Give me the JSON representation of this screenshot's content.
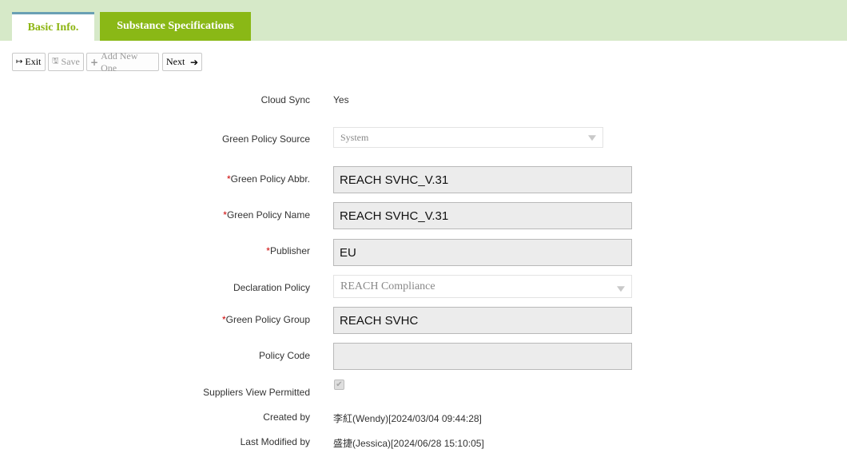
{
  "tabs": [
    {
      "label": "Basic Info."
    },
    {
      "label": "Substance Specifications"
    }
  ],
  "toolbar": {
    "exit_label": "Exit",
    "save_label": "Save",
    "add_label": "Add New One",
    "next_label": "Next"
  },
  "form": {
    "cloud_sync": {
      "label": "Cloud Sync",
      "value": "Yes"
    },
    "policy_source": {
      "label": "Green Policy Source",
      "value": "System"
    },
    "policy_abbr": {
      "label": "Green Policy Abbr.",
      "value": "REACH SVHC_V.31"
    },
    "policy_name": {
      "label": "Green Policy Name",
      "value": "REACH SVHC_V.31"
    },
    "publisher": {
      "label": "Publisher",
      "value": "EU"
    },
    "declaration_policy": {
      "label": "Declaration Policy",
      "value": "REACH Compliance"
    },
    "policy_group": {
      "label": "Green Policy Group",
      "value": "REACH SVHC"
    },
    "policy_code": {
      "label": "Policy Code",
      "value": ""
    },
    "suppliers_view": {
      "label": "Suppliers View Permitted",
      "checked": true
    },
    "created_by": {
      "label": "Created by",
      "value": "李紅(Wendy)[2024/03/04 09:44:28]"
    },
    "last_modified_by": {
      "label": "Last Modified by",
      "value": "盛捷(Jessica)[2024/06/28 15:10:05]"
    }
  },
  "required_marker": "*",
  "icons": {
    "exit": "sign-out-icon",
    "save": "floppy-disk-icon",
    "add": "plus-icon",
    "next": "arrow-right-icon",
    "dropdown": "caret-down-icon",
    "checkbox": "check-icon"
  },
  "colors": {
    "tabbar_bg": "#d6e9c8",
    "active_tab_text": "#8db513",
    "inactive_tab_bg": "#8ab816",
    "required": "#cc0000"
  }
}
